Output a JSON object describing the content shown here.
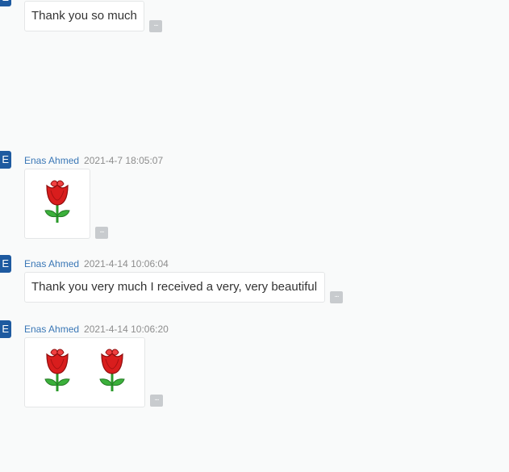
{
  "more_glyph": "...",
  "avatar_glyph": "E",
  "messages": [
    {
      "text": "Thank you so much"
    },
    {
      "sender": "Enas Ahmed",
      "timestamp": "2021-4-7 18:05:07",
      "content": "rose-sticker x1"
    },
    {
      "sender": "Enas Ahmed",
      "timestamp": "2021-4-14 10:06:04",
      "text": "Thank you very much I received a very, very beautiful"
    },
    {
      "sender": "Enas Ahmed",
      "timestamp": "2021-4-14 10:06:20",
      "content": "rose-sticker x2"
    }
  ]
}
